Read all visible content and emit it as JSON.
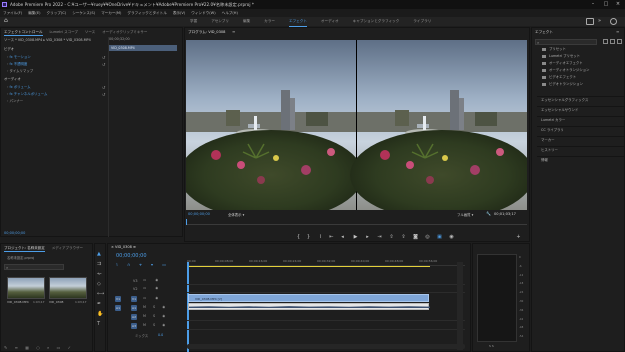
{
  "title_bar": {
    "title": "Adobe Premiere Pro 2022 - C:¥ユーザー¥ruey¥¥OneDrive¥ドキュメント¥Adobe¥Premiere Pro¥22.0¥名称未設定.prproj *"
  },
  "menu": [
    "ファイル(F)",
    "編集(E)",
    "クリップ(C)",
    "シーケンス(S)",
    "マーカー(M)",
    "グラフィックとタイトル",
    "表示(V)",
    "ウィンドウ(W)",
    "ヘルプ(H)"
  ],
  "workspaces": [
    "学習",
    "アセンブリ",
    "編集",
    "カラー",
    "エフェクト",
    "オーディオ",
    "キャプションとグラフィック",
    "ライブラリ"
  ],
  "active_workspace": "エフェクト",
  "effect_controls": {
    "tabs": [
      "エフェクトコントロール",
      "Lumetri スコープ",
      "ソース",
      "オーディオクリップミキサー"
    ],
    "clip_path": "ソース * VID_0308.MP4 ▸ VID_0308 * VID_0308.MP4",
    "timecode_ruler": "00;00;32;00",
    "clip_chip": "VID_0308.MP4",
    "sections": [
      {
        "label": "ビデオ",
        "header": true
      },
      {
        "label": "fx モーション"
      },
      {
        "label": "fx 不透明度"
      },
      {
        "label": "タイムリマップ"
      },
      {
        "label": "オーディオ",
        "header": true
      },
      {
        "label": "fx ボリューム"
      },
      {
        "label": "fx チャンネルボリューム"
      },
      {
        "label": "パンナー"
      }
    ],
    "timecode": "00;00;00;00"
  },
  "program_monitor": {
    "title": "プログラム: VID_0308",
    "menu_icon": "≡",
    "timecode_current": "00;00;00;00",
    "fit": "全体表示",
    "quality": "フル画質",
    "timecode_duration": "00;01;03;17"
  },
  "effects_panel": {
    "title": "エフェクト",
    "items": [
      "プリセット",
      "Lumetri プリセット",
      "オーディオエフェクト",
      "オーディオトランジション",
      "ビデオエフェクト",
      "ビデオトランジション"
    ],
    "sections": [
      "エッセンシャルグラフィックス",
      "エッセンシャルサウンド",
      "Lumetri カラー",
      "CC ライブラリ",
      "マーカー",
      "ヒストリー",
      "情報"
    ]
  },
  "project_panel": {
    "tabs": [
      "プロジェクト: 名称未設定",
      "メディアブラウザー"
    ],
    "file": "名称未設定.prproj",
    "items": [
      {
        "name": "VID_0308.MP4",
        "duration": "1:03;17"
      },
      {
        "name": "VID_0308",
        "duration": "1:03;17"
      }
    ]
  },
  "timeline": {
    "tab": "VID_0308",
    "timecode": "00;00;00;00",
    "ruler": [
      "00;00",
      "00;00;08;00",
      "00;00;16;00",
      "00;00;24;00",
      "00;00;32;00",
      "00;00;40;00",
      "00;00;48;00",
      "00;00;56;00",
      "00;01;04;02"
    ],
    "tracks": [
      "V3",
      "V2",
      "V1",
      "A1",
      "A2",
      "A3"
    ],
    "mix": "ミックス",
    "mix_value": "0.0",
    "video_clip": "VID_0308.MP4 [V]"
  },
  "audio_meter": {
    "scale": [
      "0",
      "-6",
      "-12",
      "-18",
      "-24",
      "-30",
      "-36",
      "-42",
      "-48",
      "-54"
    ],
    "footer": "S S"
  },
  "colors": {
    "accent": "#4d9ee8",
    "clip_video": "#7fa6d8",
    "playhead": "#4d9ee8",
    "work_area": "#e3d03a"
  }
}
